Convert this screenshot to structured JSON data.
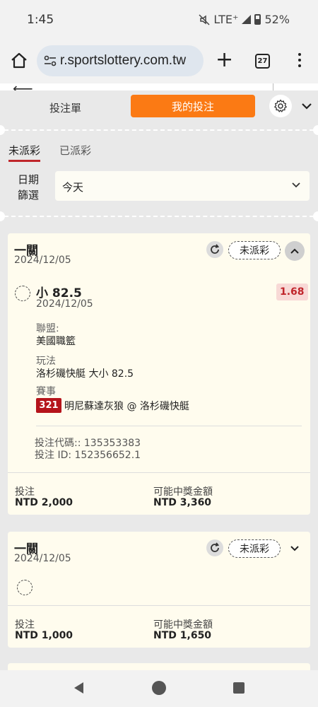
{
  "status_bar": {
    "time": "1:45",
    "network": "LTE⁺",
    "battery": "52%"
  },
  "browser": {
    "url": "r.sportslottery.com.tw",
    "tab_count": "27"
  },
  "tabs": {
    "bet_slip": "投注單",
    "my_bets": "我的投注"
  },
  "sub_tabs": {
    "unsettled": "未派彩",
    "settled": "已派彩"
  },
  "date_filter": {
    "label": "日期篩選",
    "value": "今天"
  },
  "cards": [
    {
      "type": "一關",
      "date": "2024/12/05",
      "status": "未派彩",
      "selection": {
        "title": "小 82.5",
        "date": "2024/12/05",
        "odds": "1.68",
        "league_label": "聯盟:",
        "league": "美國職籃",
        "market_label": "玩法",
        "market": "洛杉磯快艇 大小 82.5",
        "event_label": "賽事",
        "game_number": "321",
        "event": "明尼蘇達灰狼 @ 洛杉磯快艇"
      },
      "bet_code": "投注代碼:: 135353383",
      "bet_id": "投注 ID: 152356652.1",
      "stake_label": "投注",
      "stake": "NTD 2,000",
      "payout_label": "可能中獎金額",
      "payout": "NTD 3,360"
    },
    {
      "type": "一關",
      "date": "2024/12/05",
      "status": "未派彩",
      "stake_label": "投注",
      "stake": "NTD 1,000",
      "payout_label": "可能中獎金額",
      "payout": "NTD 1,650"
    }
  ]
}
